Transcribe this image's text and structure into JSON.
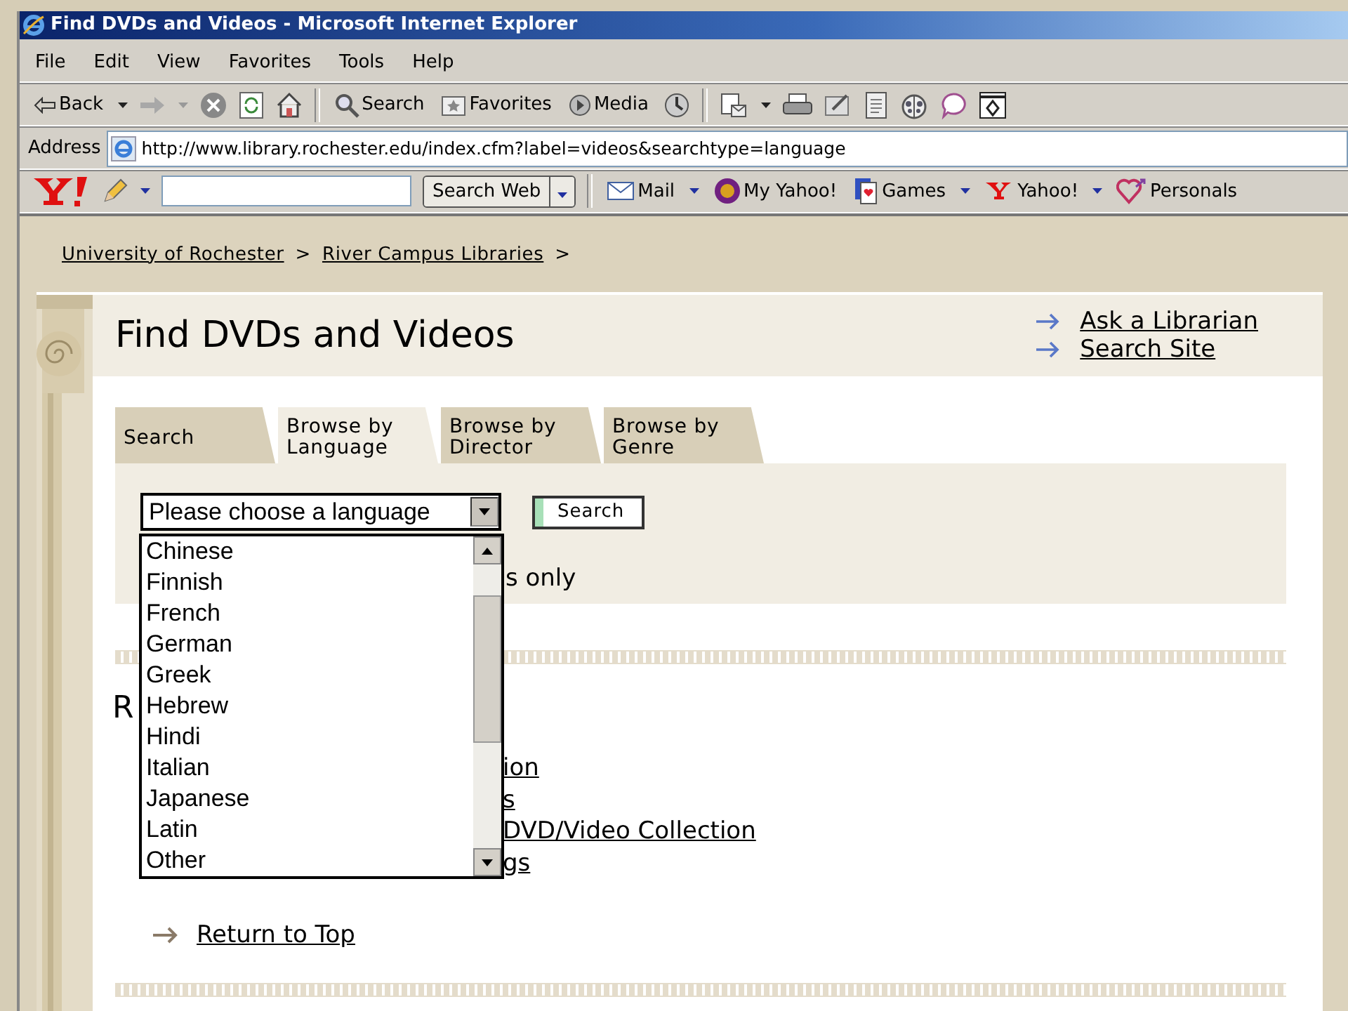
{
  "window": {
    "title": "Find DVDs and Videos - Microsoft Internet Explorer"
  },
  "menu_bar": [
    "File",
    "Edit",
    "View",
    "Favorites",
    "Tools",
    "Help"
  ],
  "toolbar": [
    {
      "kind": "back",
      "label": "Back"
    },
    {
      "kind": "search",
      "label": "Search"
    },
    {
      "kind": "favorites",
      "label": "Favorites"
    },
    {
      "kind": "media",
      "label": "Media"
    }
  ],
  "address_bar": {
    "label": "Address",
    "url": "http://www.library.rochester.edu/index.cfm?label=videos&searchtype=language"
  },
  "yahoo_toolbar": {
    "search_button": "Search Web",
    "items": [
      {
        "kind": "mail",
        "label": "Mail"
      },
      {
        "kind": "myyahoo",
        "label": "My Yahoo!"
      },
      {
        "kind": "games",
        "label": "Games"
      },
      {
        "kind": "yahoo",
        "label": "Yahoo!"
      },
      {
        "kind": "personals",
        "label": "Personals"
      }
    ]
  },
  "breadcrumb": [
    "University of Rochester",
    "River Campus Libraries"
  ],
  "breadcrumb_separator": ">",
  "page_title": "Find DVDs and Videos",
  "side_links": [
    "Ask a Librarian",
    "Search Site"
  ],
  "tabs": [
    {
      "label": "Search",
      "selected": false
    },
    {
      "label": "Browse by Language",
      "selected": true
    },
    {
      "label": "Browse by Director",
      "selected": false
    },
    {
      "label": "Browse by Genre",
      "selected": false
    }
  ],
  "language_select": {
    "placeholder": "Please choose a language",
    "expanded": true,
    "options": [
      {
        "label": "Chinese",
        "selected": false
      },
      {
        "label": "Finnish",
        "selected": false
      },
      {
        "label": "French",
        "selected": false
      },
      {
        "label": "German",
        "selected": false
      },
      {
        "label": "Greek",
        "selected": false
      },
      {
        "label": "Hebrew",
        "selected": false
      },
      {
        "label": "Hindi",
        "selected": false
      },
      {
        "label": "Italian",
        "selected": false
      },
      {
        "label": "Japanese",
        "selected": false
      },
      {
        "label": "Latin",
        "selected": false
      },
      {
        "label": "Other",
        "selected": false
      }
    ]
  },
  "search_button": "Search",
  "option_label_fragment": "s only",
  "heading_fragment": "R",
  "link_fragments": [
    "ion",
    "s",
    "DVD/Video Collection",
    "gs"
  ],
  "return_link": "Return to Top"
}
